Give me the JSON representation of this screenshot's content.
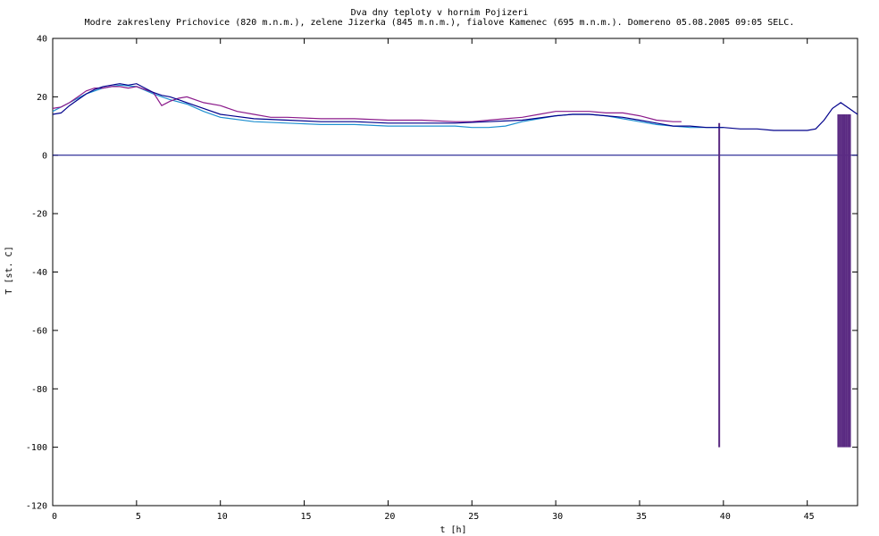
{
  "chart_data": {
    "type": "line",
    "title": "Dva dny teploty v hornim Pojizeri",
    "subtitle": "Modre zakresleny Prichovice (820 m.n.m.), zelene Jizerka (845 m.n.m.), fialove Kamenec (695 m.n.m.). Domereno 05.08.2005 09:05 SELC.",
    "xlabel": "t [h]",
    "ylabel": "T [st. C]",
    "xlim": [
      0,
      48
    ],
    "ylim": [
      -120,
      40
    ],
    "x_ticks": [
      "0",
      "5",
      "10",
      "15",
      "20",
      "25",
      "30",
      "35",
      "40",
      "45"
    ],
    "y_ticks": [
      "40",
      "20",
      "0",
      "-20",
      "-40",
      "-60",
      "-80",
      "-100",
      "-120"
    ],
    "zero_line": 0,
    "grid": false,
    "legend": "none",
    "colors": {
      "Prichovice": "#00008b",
      "Jizerka": "#1e90d0",
      "Kamenec": "#8b1a8b",
      "spikes": "#5a2a82",
      "zero_line": "#000080",
      "frame": "#000000"
    },
    "series": [
      {
        "key": "Prichovice",
        "x": [
          0,
          0.5,
          1,
          1.5,
          2,
          2.5,
          3,
          3.5,
          4,
          4.5,
          5,
          5.5,
          6,
          6.5,
          7,
          7.5,
          8,
          9,
          10,
          12,
          14,
          16,
          18,
          20,
          22,
          24,
          26,
          28,
          30,
          31,
          32,
          33,
          34,
          35,
          36,
          37,
          38,
          39,
          40,
          41,
          42,
          43,
          44,
          45,
          45.5,
          46,
          46.5,
          47,
          47.5,
          48
        ],
        "y": [
          14,
          14.5,
          17,
          19,
          21,
          22.5,
          23.5,
          24,
          24.5,
          24,
          24.5,
          23,
          21.5,
          20.5,
          20,
          19,
          18,
          16,
          14,
          12.5,
          12,
          11.5,
          11.5,
          11,
          11,
          11,
          11.5,
          12,
          13.5,
          14,
          14,
          13.5,
          13,
          12,
          11,
          10,
          10,
          9.5,
          9.5,
          9,
          9,
          8.5,
          8.5,
          8.5,
          9,
          12,
          16,
          18,
          16,
          14
        ]
      },
      {
        "key": "Jizerka",
        "x": [
          0,
          1,
          2,
          3,
          4,
          5,
          6,
          7,
          8,
          9,
          10,
          12,
          14,
          16,
          18,
          20,
          22,
          24,
          25,
          26,
          27,
          28,
          29,
          30,
          31,
          32,
          33,
          34,
          35,
          36,
          37,
          38,
          39,
          40
        ],
        "y": [
          15,
          18,
          21,
          23,
          24,
          23.5,
          21,
          19,
          17.5,
          15,
          13,
          11.5,
          11,
          10.5,
          10.5,
          10,
          10,
          10,
          9.5,
          9.5,
          10,
          11.5,
          12.5,
          13.5,
          14,
          14,
          13.5,
          12.5,
          11.5,
          10.5,
          10,
          9.5,
          9.5,
          9.5
        ]
      },
      {
        "key": "Kamenec",
        "x": [
          0,
          0.5,
          1,
          1.5,
          2,
          2.5,
          3,
          3.5,
          4,
          4.5,
          5,
          5.5,
          6,
          6.5,
          7,
          7.5,
          8,
          9,
          10,
          11,
          12,
          13,
          14,
          16,
          18,
          20,
          22,
          24,
          25,
          26,
          27,
          28,
          29,
          30,
          31,
          32,
          33,
          34,
          35,
          36,
          37,
          37.5
        ],
        "y": [
          16,
          16.5,
          18,
          20,
          22,
          23,
          23,
          23.5,
          23.5,
          23,
          23.5,
          22.5,
          21.5,
          17,
          18.5,
          19.5,
          20,
          18,
          17,
          15,
          14,
          13,
          13,
          12.5,
          12.5,
          12,
          12,
          11.5,
          11.5,
          12,
          12.5,
          13,
          14,
          15,
          15,
          15,
          14.5,
          14.5,
          13.5,
          12,
          11.5,
          11.5
        ]
      }
    ],
    "spikes": [
      {
        "x": 39.75,
        "from": 11,
        "to": -100
      },
      {
        "x": 46.85,
        "from": 14,
        "to": -100
      },
      {
        "x": 46.95,
        "from": 14,
        "to": -100
      },
      {
        "x": 47.05,
        "from": 14,
        "to": -100
      },
      {
        "x": 47.15,
        "from": 14,
        "to": -100
      },
      {
        "x": 47.25,
        "from": 14,
        "to": -100
      },
      {
        "x": 47.35,
        "from": 14,
        "to": -100
      },
      {
        "x": 47.45,
        "from": 14,
        "to": -100
      },
      {
        "x": 47.55,
        "from": 14,
        "to": -100
      }
    ]
  }
}
